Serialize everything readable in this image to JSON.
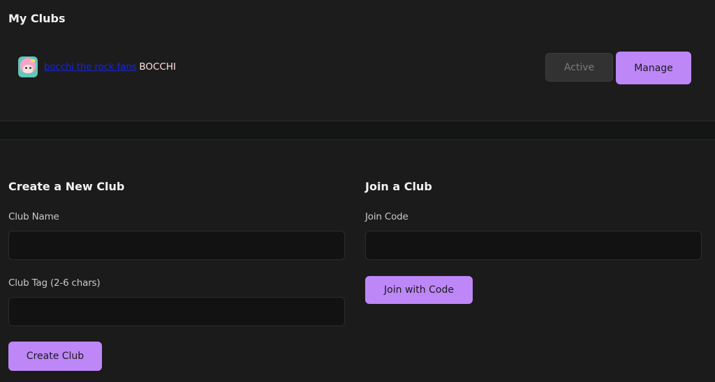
{
  "my_clubs": {
    "title": "My Clubs",
    "clubs": [
      {
        "name": "bocchi the rock fans",
        "tag": "BOCCHI",
        "status_label": "Active",
        "manage_label": "Manage"
      }
    ]
  },
  "create_club": {
    "title": "Create a New Club",
    "name_label": "Club Name",
    "name_value": "",
    "tag_label": "Club Tag (2-6 chars)",
    "tag_value": "",
    "submit_label": "Create Club"
  },
  "join_club": {
    "title": "Join a Club",
    "code_label": "Join Code",
    "code_value": "",
    "submit_label": "Join with Code"
  },
  "colors": {
    "accent": "#be87f8",
    "background": "#1b1b1b",
    "input_background": "#121212",
    "link": "#1a24d9"
  }
}
